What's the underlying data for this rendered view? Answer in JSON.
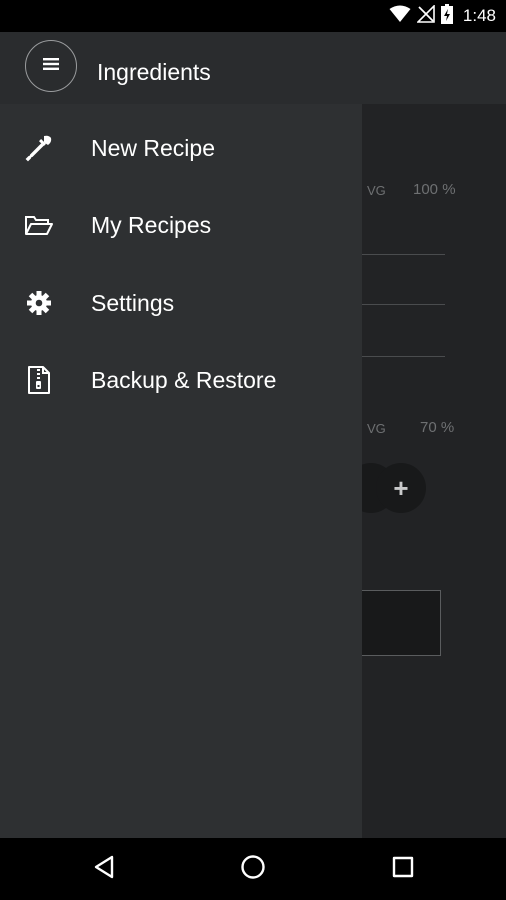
{
  "status_bar": {
    "time": "1:48",
    "icons": [
      "wifi-icon",
      "no-signal-icon",
      "battery-charging-icon"
    ]
  },
  "app_bar": {
    "title": "Ingredients",
    "menu_icon": "menu-icon"
  },
  "drawer": {
    "items": [
      {
        "label": "New Recipe",
        "icon": "dropper-icon"
      },
      {
        "label": "My Recipes",
        "icon": "folder-open-icon"
      },
      {
        "label": "Settings",
        "icon": "gear-icon"
      },
      {
        "label": "Backup & Restore",
        "icon": "zip-file-icon"
      }
    ]
  },
  "background": {
    "vg_label_1": "VG",
    "vg_value_1": "100 %",
    "vg_label_2": "VG",
    "vg_value_2": "70 %",
    "plus_label": "+"
  },
  "nav_bar": {
    "buttons": [
      "back-icon",
      "home-icon",
      "recents-icon"
    ]
  }
}
